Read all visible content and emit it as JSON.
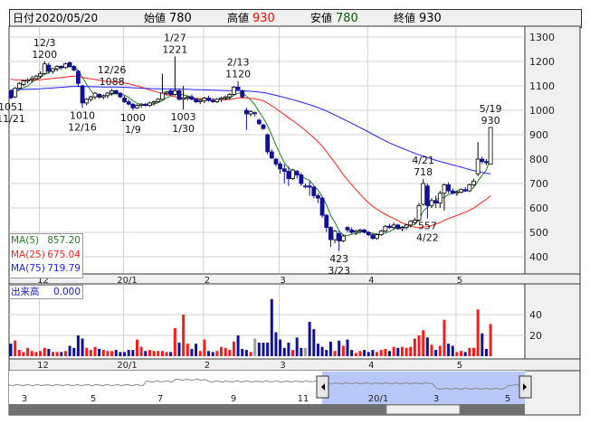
{
  "header": {
    "date_label": "日付",
    "date": "2020/05/20",
    "open_label": "始値",
    "open": "780",
    "high_label": "高値",
    "high": "930",
    "low_label": "安値",
    "low": "780",
    "close_label": "終値",
    "close": "930"
  },
  "colors": {
    "up_volume": "#ff1a1a",
    "down_volume": "#10109a",
    "flat_volume": "#a0a0a0",
    "down_candle": "#10109a",
    "ma5": "#208020",
    "ma25": "#ff2020",
    "ma75": "#2020ff",
    "header_high": "#ff0000",
    "header_low": "#006000",
    "nav_fill": "#b8c8f8"
  },
  "chart_data": {
    "type": "candlestick",
    "price_axis": {
      "ticks": [
        1300,
        1200,
        1100,
        1000,
        900,
        800,
        700,
        600,
        500,
        400
      ],
      "ylim": [
        350,
        1310
      ]
    },
    "month_labels": [
      {
        "label": "12",
        "index": 7
      },
      {
        "label": "20/1",
        "index": 27
      },
      {
        "label": "2",
        "index": 46
      },
      {
        "label": "3",
        "index": 64
      },
      {
        "label": "4",
        "index": 85
      },
      {
        "label": "5",
        "index": 106
      }
    ],
    "legend": [
      {
        "name": "MA(5)",
        "value": "857.20"
      },
      {
        "name": "MA(25)",
        "value": "675.04"
      },
      {
        "name": "MA(75)",
        "value": "719.79"
      }
    ],
    "volume": {
      "label": "出来高",
      "value": "0.000",
      "ticks": [
        40,
        20
      ]
    },
    "annotations": [
      {
        "i": 0,
        "pos": "below",
        "lines": [
          "1051",
          "11/21"
        ]
      },
      {
        "i": 8,
        "pos": "above",
        "lines": [
          "12/3",
          "1200"
        ]
      },
      {
        "i": 17,
        "pos": "below",
        "lines": [
          "1010",
          "12/16"
        ]
      },
      {
        "i": 24,
        "pos": "above",
        "lines": [
          "12/26",
          "1088"
        ]
      },
      {
        "i": 29,
        "pos": "below",
        "lines": [
          "1000",
          "1/9"
        ]
      },
      {
        "i": 39,
        "pos": "above",
        "lines": [
          "1/27",
          "1221"
        ]
      },
      {
        "i": 41,
        "pos": "below",
        "lines": [
          "1003",
          "1/30"
        ]
      },
      {
        "i": 54,
        "pos": "above",
        "lines": [
          "2/13",
          "1120"
        ]
      },
      {
        "i": 78,
        "pos": "below",
        "lines": [
          "423",
          "3/23"
        ]
      },
      {
        "i": 98,
        "pos": "above",
        "lines": [
          "4/21",
          "718"
        ]
      },
      {
        "i": 99,
        "pos": "below",
        "lines": [
          "557",
          "4/22"
        ]
      },
      {
        "i": 114,
        "pos": "above",
        "lines": [
          "5/19",
          "930"
        ]
      }
    ],
    "ohlcv": [
      [
        1080,
        1085,
        1045,
        1051,
        12
      ],
      [
        1055,
        1095,
        1050,
        1090,
        15
      ],
      [
        1090,
        1115,
        1085,
        1110,
        6
      ],
      [
        1105,
        1125,
        1100,
        1120,
        4
      ],
      [
        1120,
        1130,
        1110,
        1125,
        8
      ],
      [
        1125,
        1140,
        1115,
        1130,
        5
      ],
      [
        1130,
        1145,
        1125,
        1140,
        4
      ],
      [
        1140,
        1160,
        1130,
        1150,
        5
      ],
      [
        1150,
        1200,
        1145,
        1190,
        8
      ],
      [
        1185,
        1195,
        1150,
        1160,
        7
      ],
      [
        1160,
        1175,
        1150,
        1170,
        4
      ],
      [
        1170,
        1185,
        1160,
        1180,
        4
      ],
      [
        1180,
        1185,
        1165,
        1175,
        4
      ],
      [
        1175,
        1195,
        1170,
        1190,
        5
      ],
      [
        1195,
        1200,
        1175,
        1180,
        10
      ],
      [
        1180,
        1185,
        1160,
        1165,
        8
      ],
      [
        1160,
        1165,
        1100,
        1110,
        20
      ],
      [
        1100,
        1105,
        1010,
        1030,
        17
      ],
      [
        1030,
        1050,
        1020,
        1045,
        8
      ],
      [
        1045,
        1060,
        1035,
        1055,
        6
      ],
      [
        1055,
        1075,
        1045,
        1070,
        9
      ],
      [
        1065,
        1070,
        1050,
        1055,
        7
      ],
      [
        1055,
        1065,
        1045,
        1060,
        6
      ],
      [
        1060,
        1075,
        1050,
        1070,
        5
      ],
      [
        1070,
        1088,
        1060,
        1080,
        5
      ],
      [
        1080,
        1085,
        1065,
        1070,
        6
      ],
      [
        1070,
        1075,
        1050,
        1055,
        4
      ],
      [
        1050,
        1060,
        1030,
        1035,
        4
      ],
      [
        1035,
        1045,
        1020,
        1025,
        6
      ],
      [
        1025,
        1030,
        1000,
        1010,
        6
      ],
      [
        1010,
        1025,
        1005,
        1020,
        16
      ],
      [
        1020,
        1030,
        1010,
        1025,
        9
      ],
      [
        1025,
        1030,
        1015,
        1020,
        5
      ],
      [
        1020,
        1035,
        1015,
        1030,
        6
      ],
      [
        1030,
        1040,
        1020,
        1035,
        5
      ],
      [
        1035,
        1050,
        1030,
        1045,
        5
      ],
      [
        1045,
        1150,
        1040,
        1070,
        5
      ],
      [
        1070,
        1080,
        1060,
        1075,
        4
      ],
      [
        1080,
        1090,
        1060,
        1065,
        4
      ],
      [
        1065,
        1221,
        1060,
        1080,
        27
      ],
      [
        1080,
        1090,
        1040,
        1045,
        13
      ],
      [
        1045,
        1100,
        1003,
        1050,
        40
      ],
      [
        1050,
        1060,
        1040,
        1055,
        12
      ],
      [
        1055,
        1065,
        1040,
        1045,
        7
      ],
      [
        1045,
        1050,
        1030,
        1035,
        12
      ],
      [
        1035,
        1045,
        1025,
        1040,
        5
      ],
      [
        1040,
        1055,
        1030,
        1050,
        16
      ],
      [
        1050,
        1060,
        1035,
        1040,
        5
      ],
      [
        1040,
        1050,
        1030,
        1035,
        4
      ],
      [
        1035,
        1050,
        1030,
        1045,
        5
      ],
      [
        1045,
        1055,
        1035,
        1050,
        9
      ],
      [
        1050,
        1060,
        1040,
        1055,
        8
      ],
      [
        1055,
        1070,
        1045,
        1065,
        6
      ],
      [
        1065,
        1100,
        1060,
        1095,
        14
      ],
      [
        1095,
        1120,
        1080,
        1085,
        20
      ],
      [
        1080,
        1085,
        1050,
        1055,
        7
      ],
      [
        1000,
        1010,
        920,
        985,
        6
      ],
      [
        985,
        1000,
        975,
        995,
        4
      ],
      [
        990,
        995,
        975,
        990,
        17
      ],
      [
        960,
        965,
        940,
        945,
        13
      ],
      [
        940,
        945,
        920,
        925,
        13
      ],
      [
        900,
        905,
        820,
        830,
        13
      ],
      [
        830,
        840,
        800,
        805,
        55
      ],
      [
        800,
        805,
        770,
        780,
        23
      ],
      [
        780,
        790,
        740,
        760,
        16
      ],
      [
        760,
        780,
        700,
        750,
        8
      ],
      [
        750,
        770,
        690,
        720,
        13
      ],
      [
        720,
        760,
        715,
        755,
        6
      ],
      [
        750,
        755,
        720,
        735,
        18
      ],
      [
        735,
        745,
        690,
        700,
        8
      ],
      [
        690,
        700,
        680,
        690,
        8
      ],
      [
        690,
        710,
        650,
        685,
        33
      ],
      [
        685,
        690,
        640,
        650,
        26
      ],
      [
        650,
        660,
        620,
        640,
        12
      ],
      [
        640,
        645,
        560,
        570,
        9
      ],
      [
        570,
        575,
        500,
        520,
        6
      ],
      [
        520,
        525,
        440,
        470,
        14
      ],
      [
        470,
        510,
        455,
        505,
        5
      ],
      [
        495,
        505,
        423,
        465,
        15
      ],
      [
        465,
        490,
        460,
        485,
        10
      ],
      [
        520,
        525,
        500,
        510,
        16
      ],
      [
        510,
        520,
        495,
        500,
        6
      ],
      [
        500,
        510,
        490,
        505,
        3
      ],
      [
        505,
        515,
        495,
        510,
        5
      ],
      [
        510,
        515,
        495,
        500,
        6
      ],
      [
        500,
        505,
        485,
        490,
        4
      ],
      [
        490,
        495,
        470,
        475,
        6
      ],
      [
        475,
        495,
        470,
        490,
        4
      ],
      [
        490,
        510,
        485,
        505,
        6
      ],
      [
        505,
        530,
        500,
        525,
        7
      ],
      [
        525,
        535,
        515,
        520,
        5
      ],
      [
        520,
        540,
        510,
        530,
        9
      ],
      [
        530,
        535,
        510,
        515,
        8
      ],
      [
        515,
        525,
        505,
        520,
        9
      ],
      [
        520,
        535,
        510,
        530,
        8
      ],
      [
        530,
        550,
        520,
        545,
        9
      ],
      [
        540,
        560,
        535,
        550,
        17
      ],
      [
        550,
        620,
        545,
        610,
        20
      ],
      [
        615,
        718,
        610,
        700,
        25
      ],
      [
        690,
        700,
        557,
        610,
        18
      ],
      [
        610,
        640,
        600,
        630,
        11
      ],
      [
        630,
        650,
        600,
        620,
        6
      ],
      [
        620,
        670,
        600,
        660,
        10
      ],
      [
        660,
        700,
        590,
        695,
        35
      ],
      [
        695,
        705,
        660,
        670,
        12
      ],
      [
        670,
        680,
        655,
        660,
        10
      ],
      [
        660,
        670,
        650,
        665,
        4
      ],
      [
        665,
        680,
        660,
        675,
        5
      ],
      [
        675,
        685,
        665,
        670,
        4
      ],
      [
        670,
        700,
        665,
        695,
        8
      ],
      [
        695,
        720,
        690,
        710,
        8
      ],
      [
        740,
        870,
        730,
        800,
        45
      ],
      [
        800,
        810,
        780,
        790,
        22
      ],
      [
        790,
        800,
        775,
        785,
        7
      ],
      [
        780,
        930,
        780,
        930,
        31
      ]
    ]
  },
  "navigator": {
    "labels": [
      "3",
      "5",
      "7",
      "9",
      "11",
      "20/1",
      "3",
      "5"
    ]
  }
}
